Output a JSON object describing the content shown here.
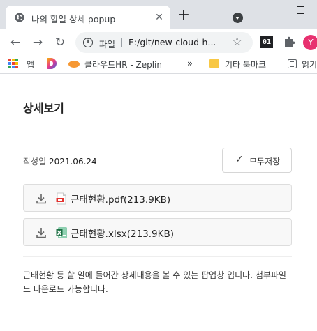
{
  "browser": {
    "tab": {
      "title": "나의 할일 상세 popup"
    },
    "omnibox": {
      "label": "파일",
      "url": "E:/git/new-cloud-h..."
    },
    "extension_label": "01",
    "avatar_initial": "Y",
    "bookmarks": [
      {
        "label": "앱",
        "icon": "apps-grid-icon"
      },
      {
        "label": "",
        "icon": "d-logo-icon"
      },
      {
        "label": "클라우드HR - Zeplin",
        "icon": "zeplin-icon"
      },
      {
        "label": "»",
        "icon": "overflow-chevron"
      },
      {
        "label": "기타 북마크",
        "icon": "folder-icon"
      },
      {
        "label": "읽기",
        "icon": "reading-list-icon"
      }
    ]
  },
  "popup": {
    "title": "상세보기",
    "date_label": "작성일",
    "date_value": "2021.06.24",
    "save_all_label": "모두저장",
    "attachments": [
      {
        "name": "근태현황.pdf(213.9KB)",
        "type": "pdf"
      },
      {
        "name": "근태현황.xlsx(213.9KB)",
        "type": "xlsx"
      }
    ],
    "description": "근태현황 등 할 일에 들어간 상세내용을 볼 수 있는 팝업창 입니다. 첨부파일도 다운로드 가능합니다."
  },
  "colors": {
    "tabstrip_bg": "#dee1e6",
    "omnibox_bg": "#f1f3f4",
    "avatar_bg": "#e8306f",
    "pdf_red": "#e2322f",
    "excel_green": "#1e7145"
  }
}
